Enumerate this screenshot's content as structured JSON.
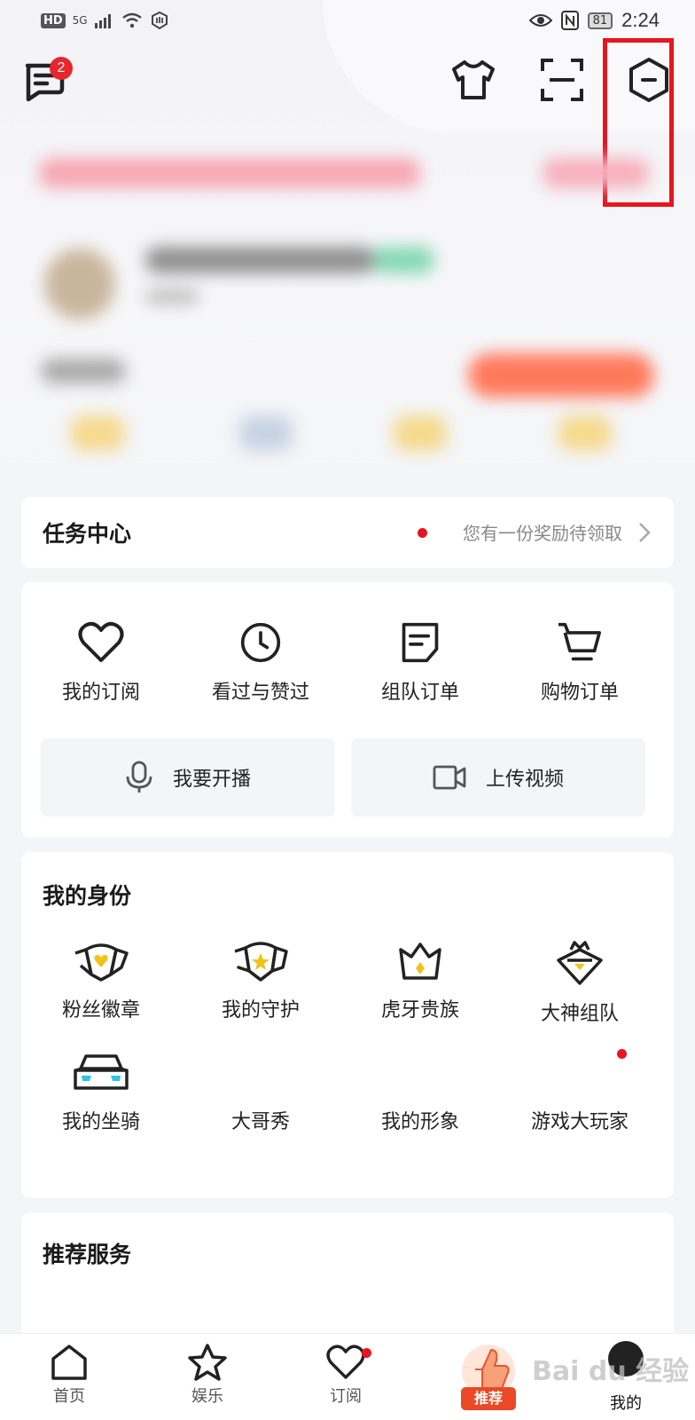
{
  "status_bar": {
    "hd": "HD",
    "signal": "5G",
    "battery": "81",
    "time": "2:24"
  },
  "header": {
    "message_badge_count": "2"
  },
  "task_center": {
    "title": "任务中心",
    "hint": "您有一份奖励待领取"
  },
  "functions": {
    "items": [
      {
        "label": "我的订阅",
        "icon": "heart-icon"
      },
      {
        "label": "看过与赞过",
        "icon": "clock-icon"
      },
      {
        "label": "组队订单",
        "icon": "note-icon"
      },
      {
        "label": "购物订单",
        "icon": "cart-icon"
      }
    ],
    "broadcast_label": "我要开播",
    "upload_label": "上传视频"
  },
  "identity": {
    "title": "我的身份",
    "items": [
      {
        "label": "粉丝徽章",
        "icon": "fan-badge-icon"
      },
      {
        "label": "我的守护",
        "icon": "guard-shield-icon"
      },
      {
        "label": "虎牙贵族",
        "icon": "noble-crown-icon"
      },
      {
        "label": "大神组队",
        "icon": "god-team-icon"
      },
      {
        "label": "我的坐骑",
        "icon": "car-icon"
      },
      {
        "label": "大哥秀",
        "icon": ""
      },
      {
        "label": "我的形象",
        "icon": ""
      },
      {
        "label": "游戏大玩家",
        "icon": ""
      }
    ]
  },
  "recommend": {
    "title": "推荐服务"
  },
  "bottom_nav": {
    "items": [
      {
        "label": "首页",
        "icon": "home-icon"
      },
      {
        "label": "娱乐",
        "icon": "star-icon"
      },
      {
        "label": "订阅",
        "icon": "heart-icon"
      },
      {
        "label": "推荐",
        "icon": "thumb-icon"
      },
      {
        "label": "我的",
        "icon": "avatar"
      }
    ]
  },
  "watermark": "Bai du 经验",
  "colors": {
    "accent_red": "#e8141f",
    "gold": "#f2c21b",
    "cyan": "#2bc3e6"
  }
}
